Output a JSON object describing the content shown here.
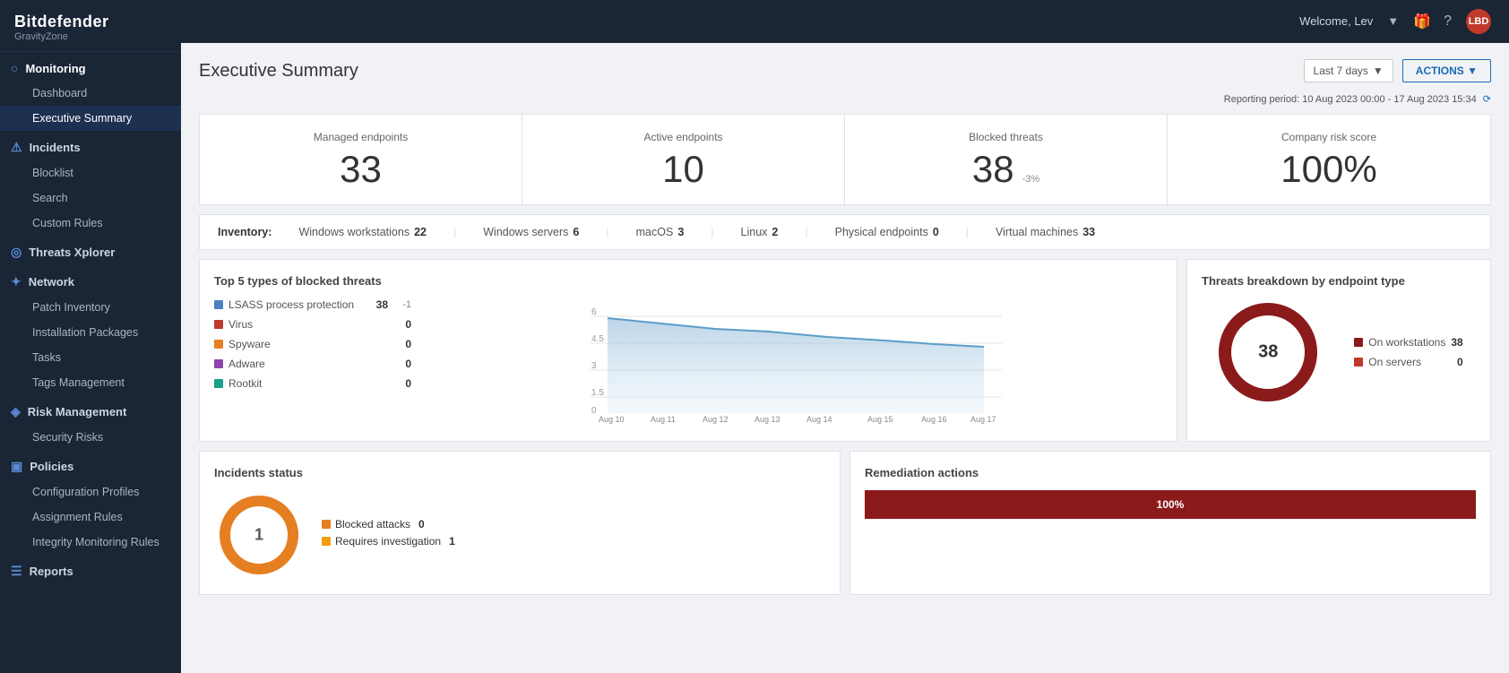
{
  "branding": {
    "name": "Bitdefender",
    "subtitle": "GravityZone"
  },
  "topbar": {
    "welcome": "Welcome, Lev",
    "avatar_initials": "LBD"
  },
  "sidebar": {
    "sections": [
      {
        "id": "monitoring",
        "label": "Monitoring",
        "icon": "○",
        "active": true,
        "items": [
          {
            "id": "dashboard",
            "label": "Dashboard",
            "active": false
          },
          {
            "id": "executive-summary",
            "label": "Executive Summary",
            "active": true
          }
        ]
      },
      {
        "id": "incidents",
        "label": "Incidents",
        "icon": "⚠",
        "items": [
          {
            "id": "blocklist",
            "label": "Blocklist",
            "active": false
          },
          {
            "id": "search",
            "label": "Search",
            "active": false
          },
          {
            "id": "custom-rules",
            "label": "Custom Rules",
            "active": false
          }
        ]
      },
      {
        "id": "threats-xplorer",
        "label": "Threats Xplorer",
        "icon": "◎",
        "items": []
      },
      {
        "id": "network",
        "label": "Network",
        "icon": "✦",
        "items": [
          {
            "id": "patch-inventory",
            "label": "Patch Inventory",
            "active": false
          },
          {
            "id": "installation-packages",
            "label": "Installation Packages",
            "active": false
          },
          {
            "id": "tasks",
            "label": "Tasks",
            "active": false
          },
          {
            "id": "tags-management",
            "label": "Tags Management",
            "active": false
          }
        ]
      },
      {
        "id": "risk-management",
        "label": "Risk Management",
        "icon": "◈",
        "items": [
          {
            "id": "security-risks",
            "label": "Security Risks",
            "active": false
          }
        ]
      },
      {
        "id": "policies",
        "label": "Policies",
        "icon": "▣",
        "items": [
          {
            "id": "configuration-profiles",
            "label": "Configuration Profiles",
            "active": false
          },
          {
            "id": "assignment-rules",
            "label": "Assignment Rules",
            "active": false
          },
          {
            "id": "integrity-monitoring-rules",
            "label": "Integrity Monitoring Rules",
            "active": false
          }
        ]
      },
      {
        "id": "reports",
        "label": "Reports",
        "icon": "☰",
        "items": []
      }
    ]
  },
  "page": {
    "title": "Executive Summary",
    "date_range": "Last 7 days",
    "reporting_period": "Reporting period: 10 Aug 2023 00:00 - 17 Aug 2023 15:34",
    "actions_label": "ACTIONS ▼"
  },
  "stats": [
    {
      "label": "Managed endpoints",
      "value": "33",
      "delta": ""
    },
    {
      "label": "Active endpoints",
      "value": "10",
      "delta": ""
    },
    {
      "label": "Blocked threats",
      "value": "38",
      "delta": "-3%"
    },
    {
      "label": "Company risk score",
      "value": "100%",
      "delta": ""
    }
  ],
  "inventory": {
    "label": "Inventory:",
    "items": [
      {
        "name": "Windows workstations",
        "count": "22"
      },
      {
        "name": "Windows servers",
        "count": "6"
      },
      {
        "name": "macOS",
        "count": "3"
      },
      {
        "name": "Linux",
        "count": "2"
      },
      {
        "name": "Physical endpoints",
        "count": "0"
      },
      {
        "name": "Virtual machines",
        "count": "33"
      }
    ]
  },
  "top_threats": {
    "title": "Top 5 types of blocked threats",
    "items": [
      {
        "name": "LSASS process protection",
        "count": "38",
        "delta": "-1",
        "color": "#4a7fc1"
      },
      {
        "name": "Virus",
        "count": "0",
        "delta": "",
        "color": "#c0392b"
      },
      {
        "name": "Spyware",
        "count": "0",
        "delta": "",
        "color": "#e67e22"
      },
      {
        "name": "Adware",
        "count": "0",
        "delta": "",
        "color": "#8e44ad"
      },
      {
        "name": "Rootkit",
        "count": "0",
        "delta": "",
        "color": "#16a085"
      }
    ],
    "chart_labels": [
      "Aug 10",
      "Aug 11",
      "Aug 12",
      "Aug 13",
      "Aug 14",
      "Aug 15",
      "Aug 16",
      "Aug 17"
    ],
    "chart_max": 6,
    "chart_values": [
      6,
      5.5,
      5,
      4.8,
      4.5,
      4.2,
      4.0,
      3.8
    ]
  },
  "threats_breakdown": {
    "title": "Threats breakdown by endpoint type",
    "total": "38",
    "items": [
      {
        "label": "On workstations",
        "count": "38",
        "color": "#8b1a1a"
      },
      {
        "label": "On servers",
        "count": "0",
        "color": "#c0392b"
      }
    ]
  },
  "incidents_status": {
    "title": "Incidents status",
    "total": "1",
    "items": [
      {
        "label": "Blocked attacks",
        "count": "0",
        "color": "#e67e22"
      },
      {
        "label": "Requires investigation",
        "count": "1",
        "color": "#f39c12"
      }
    ]
  },
  "remediation": {
    "title": "Remediation actions",
    "bar_percent": "100%",
    "bar_color": "#8b1a1a"
  }
}
